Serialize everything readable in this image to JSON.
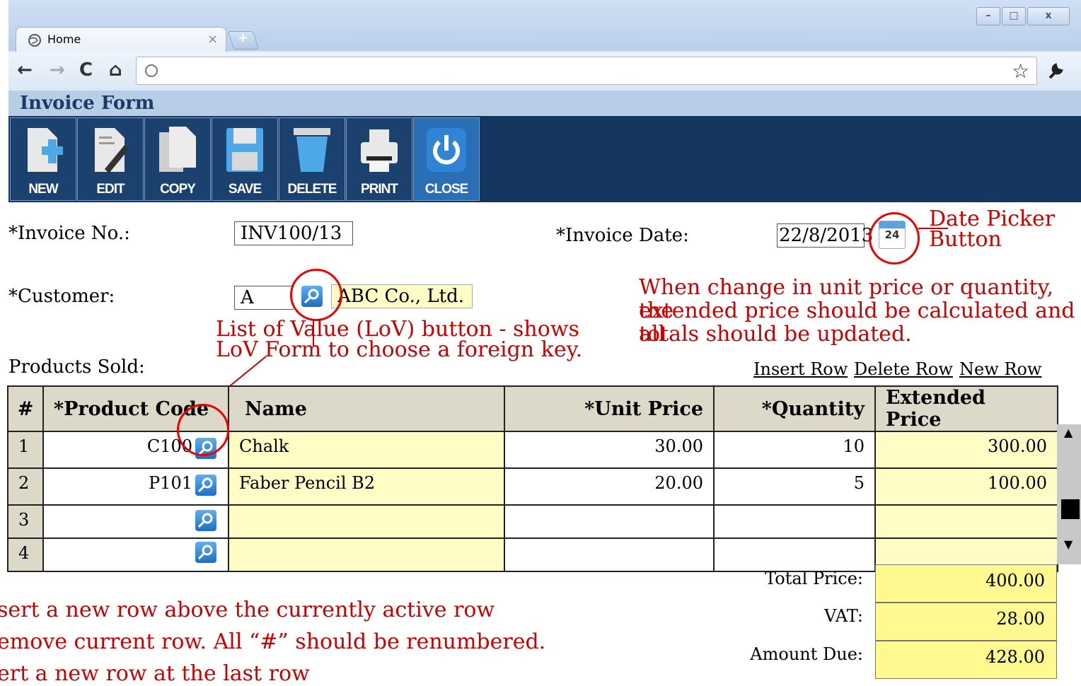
{
  "browser": {
    "tab_title": "Home",
    "tab_close": "×",
    "newtab": "+",
    "window_buttons": [
      "–",
      "□",
      "x"
    ]
  },
  "form": {
    "title": "Invoice Form",
    "toolbar": [
      "NEW",
      "EDIT",
      "COPY",
      "SAVE",
      "DELETE",
      "PRINT",
      "CLOSE"
    ],
    "invoice_no_label": "*Invoice No.:",
    "invoice_no_value": "INV100/13",
    "invoice_date_label": "*Invoice Date:",
    "invoice_date_value": "22/8/2013",
    "calendar_day": "24",
    "customer_label": "*Customer:",
    "customer_code": "A",
    "customer_name": "ABC Co., Ltd.",
    "products_label": "Products Sold:",
    "links": {
      "insert": "Insert Row",
      "delete": "Delete Row",
      "new": "New Row"
    },
    "columns": [
      "#",
      "*Product Code",
      "Name",
      "*Unit Price",
      "*Quantity",
      "Extended Price"
    ],
    "rows": [
      {
        "num": "1",
        "code": "C100",
        "name": "Chalk",
        "price": "30.00",
        "qty": "10",
        "ext": "300.00"
      },
      {
        "num": "2",
        "code": "P101",
        "name": "Faber Pencil B2",
        "price": "20.00",
        "qty": "5",
        "ext": "100.00"
      },
      {
        "num": "3",
        "code": "",
        "name": "",
        "price": "",
        "qty": "",
        "ext": ""
      },
      {
        "num": "4",
        "code": "",
        "name": "",
        "price": "",
        "qty": "",
        "ext": ""
      }
    ],
    "totals": {
      "total_label": "Total Price:",
      "total_value": "400.00",
      "vat_label": "VAT:",
      "vat_value": "28.00",
      "due_label": "Amount Due:",
      "due_value": "428.00"
    }
  },
  "annotations": {
    "date_picker_1": "Date Picker",
    "date_picker_2": "Button",
    "calc_1": "When change in unit price or quantity, the",
    "calc_2": "extended price should be calculated and all",
    "calc_3": "totals should be updated.",
    "lov_1": "List of Value (LoV) button - shows",
    "lov_2": "LoV Form to choose a foreign key.",
    "bottom_1": "sert a new row above the currently active row",
    "bottom_2": "emove current row. All “#” should be renumbered.",
    "bottom_3": "ert a new row at the last row"
  }
}
